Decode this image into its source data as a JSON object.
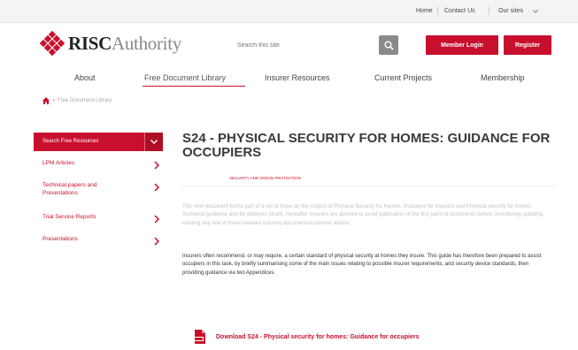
{
  "topbar": {
    "home": "Home",
    "contact": "Contact Us",
    "our_sites": "Our sites"
  },
  "brand": {
    "logo_bold": "RISC",
    "logo_light": "Authority"
  },
  "search": {
    "placeholder": "Search this site"
  },
  "header_buttons": {
    "login": "Member Login",
    "register": "Register"
  },
  "main_nav": [
    {
      "label": "About"
    },
    {
      "label": "Free Document Library"
    },
    {
      "label": "Insurer Resources"
    },
    {
      "label": "Current Projects"
    },
    {
      "label": "Membership"
    }
  ],
  "breadcrumb": {
    "current": "Free Document Library"
  },
  "sidebar": {
    "header": "Search Free Resources",
    "items": [
      {
        "label": "LPM Articles"
      },
      {
        "label": "Technical papers and Presentations"
      },
      {
        "label": "Trial Service Reports"
      },
      {
        "label": "Presentations"
      }
    ]
  },
  "document": {
    "title": "S24 - PHYSICAL SECURITY FOR HOMES: GUIDANCE FOR OCCUPIERS",
    "category": "SECURITY AND ARSON PROTECTION",
    "intro": "This new document forms part of a set of three on the subject of Physical Security for Homes: Guidance for Insurers and Physical security for homes: Technical guidance and for Advisors (draft). Hereafter Insurers are advised to avoid publication of the first parts of documents before considering updating existing any one of these relevant industry documents/customer advice.",
    "body": "Insurers often recommend, or may require, a certain standard of physical security at homes they insure. This guide has therefore been prepared to assist occupiers in this task, by briefly summarising some of the main issues relating to possible insurer requirements, and security device standards, then providing guidance via two Appendices.",
    "download": "Download S24 - Physical security for homes: Guidance for occupiers"
  },
  "colors": {
    "brand_red": "#c8102e",
    "grey_button": "#8a8a8a"
  }
}
